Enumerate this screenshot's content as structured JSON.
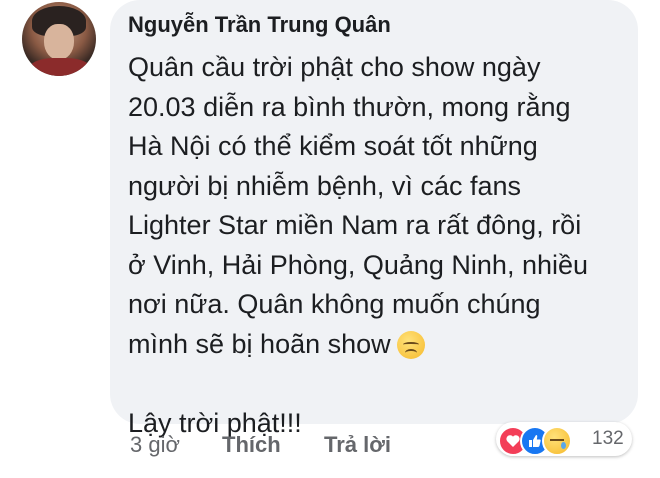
{
  "comment": {
    "author": "Nguyễn Trần Trung Quân",
    "text": "Quân cầu trời phật cho show ngày\n20.03 diễn ra bình thườn, mong rằng\nHà Nội có thể kiểm soát tốt những\nngười bị nhiễm bệnh, vì các fans\nLighter Star miền Nam ra rất đông, rồi\nở Vinh, Hải Phòng, Quảng Ninh, nhiều\nnơi nữa. Quân không muốn chúng\nmình sẽ bị hoãn show",
    "text_end": "\n\nLậy trời phật!!!",
    "emoji": "sad-face-emoji"
  },
  "actions": {
    "time": "3 giờ",
    "like_label": "Thích",
    "reply_label": "Trả lời"
  },
  "reactions": {
    "icons": [
      "love-icon",
      "like-icon",
      "sad-icon"
    ],
    "count": "132"
  },
  "colors": {
    "bubble": "#f0f2f5",
    "text": "#1c1e21",
    "muted": "#65676b",
    "love": "#f33e58",
    "like": "#1877f2"
  }
}
